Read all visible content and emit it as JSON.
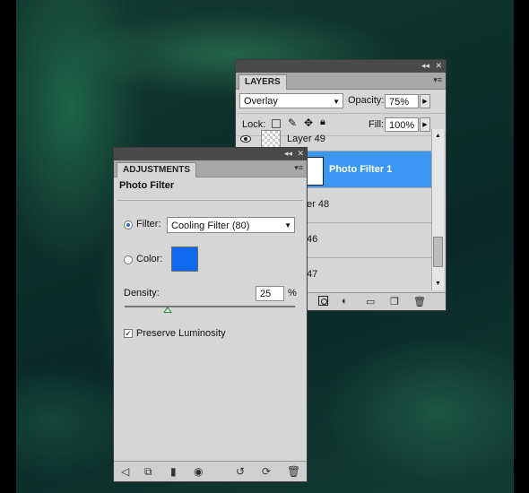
{
  "layers_panel": {
    "tab": "LAYERS",
    "collapse_icon": "◂◂",
    "close_icon": "✕",
    "menu_icon": "▾≡",
    "blend_mode": "Overlay",
    "opacity_label": "Opacity:",
    "opacity_value": "75%",
    "lock_label": "Lock:",
    "fill_label": "Fill:",
    "fill_value": "100%",
    "layers": [
      {
        "name": "Layer 49",
        "visible": true
      },
      {
        "name": "Photo Filter 1",
        "selected": true
      },
      {
        "name": "er 48"
      },
      {
        "name": "46"
      },
      {
        "name": "47"
      }
    ],
    "footer_icons": [
      "link-icon",
      "fx-icon",
      "mask-icon",
      "adjustment-icon",
      "folder-icon",
      "new-layer-icon",
      "trash-icon"
    ]
  },
  "adjustments_panel": {
    "tab": "ADJUSTMENTS",
    "collapse_icon": "◂◂",
    "close_icon": "✕",
    "menu_icon": "▾≡",
    "title": "Photo Filter",
    "filter_label": "Filter:",
    "filter_value": "Cooling Filter (80)",
    "color_label": "Color:",
    "swatch_color": "#0f6af0",
    "density_label": "Density:",
    "density_value": "25",
    "density_unit": "%",
    "density_fraction": 0.25,
    "preserve_label": "Preserve Luminosity",
    "preserve_checked": true,
    "footer_icons": [
      "back-icon",
      "clip-icon",
      "mask-icon",
      "eye-icon",
      "previous-state-icon",
      "reset-icon",
      "trash-icon"
    ]
  },
  "colors": {
    "selection": "#3a98f2",
    "panel": "#d6d6d6"
  }
}
